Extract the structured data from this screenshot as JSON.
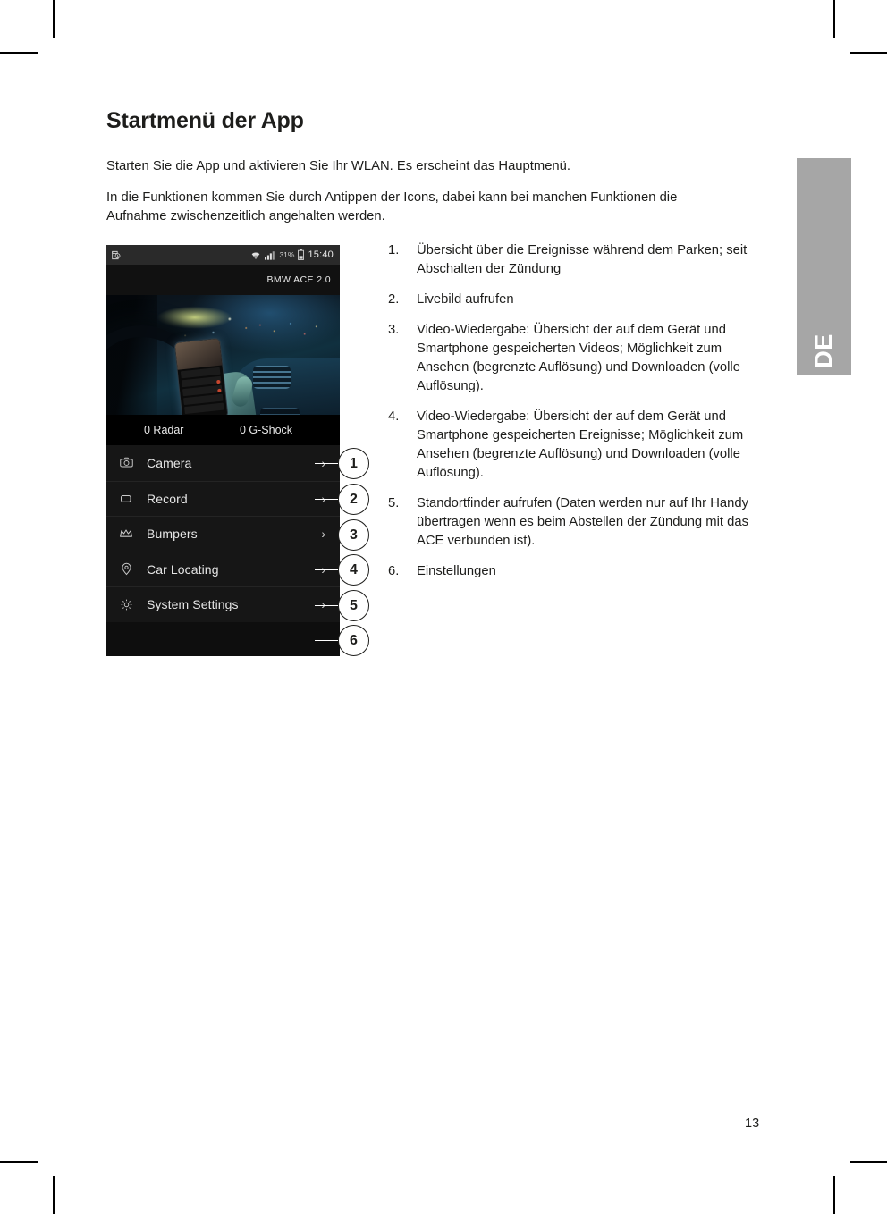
{
  "document": {
    "title": "Startmenü der App",
    "page_number": "13",
    "language_tab": "DE",
    "intro_paragraphs": [
      "Starten Sie die App und aktivieren Sie Ihr WLAN. Es erscheint das Hauptmenü.",
      "In die Funktionen kommen Sie durch Antippen der Icons, dabei kann bei manchen Funktionen die Aufnahme zwischenzeitlich angehalten werden."
    ]
  },
  "phone": {
    "statusbar": {
      "screenshot_icon": "screenshot-icon",
      "wifi_icon": "wifi-icon",
      "signal_icon": "signal-icon",
      "battery_percent": "31%",
      "battery_icon": "battery-icon",
      "clock": "15:40"
    },
    "app_title": "BMW ACE 2.0",
    "metrics": {
      "radar": "0 Radar",
      "gshock": "0 G-Shock"
    },
    "menu_items": [
      {
        "label": "Camera",
        "icon": "camera-icon",
        "chevron": "›"
      },
      {
        "label": "Record",
        "icon": "video-icon",
        "chevron": "›"
      },
      {
        "label": "Bumpers",
        "icon": "bumper-icon",
        "chevron": "›"
      },
      {
        "label": "Car Locating",
        "icon": "location-pin-icon",
        "chevron": "›"
      },
      {
        "label": "System Settings",
        "icon": "gear-icon",
        "chevron": "›"
      }
    ]
  },
  "callouts": [
    {
      "number": "1"
    },
    {
      "number": "2"
    },
    {
      "number": "3"
    },
    {
      "number": "4"
    },
    {
      "number": "5"
    },
    {
      "number": "6"
    }
  ],
  "reference_list": [
    {
      "number": "1.",
      "text": "Übersicht über die Ereignisse während dem Parken; seit Abschalten der Zündung"
    },
    {
      "number": "2.",
      "text": "Livebild aufrufen"
    },
    {
      "number": "3.",
      "text": "Video-Wiedergabe: Übersicht der auf dem Gerät und Smartphone gespeicherten Videos; Möglichkeit zum Ansehen (begrenzte Auflösung) und Downloaden (volle Auflösung)."
    },
    {
      "number": "4.",
      "text": "Video-Wiedergabe: Übersicht der auf dem Gerät und Smartphone gespeicherten Ereignisse; Möglichkeit zum Ansehen (begrenzte Auflösung) und Downloaden (volle Auflösung)."
    },
    {
      "number": "5.",
      "text": "Standortfinder aufrufen (Daten werden nur auf Ihr Handy übertragen wenn es beim Abstellen der Zündung mit das ACE verbunden ist)."
    },
    {
      "number": "6.",
      "text": "Einstellungen"
    }
  ],
  "colors": {
    "text": "#1d1d1b",
    "tab_gray": "#a6a6a6",
    "phone_bg": "#161616",
    "page_bg": "#ffffff"
  }
}
